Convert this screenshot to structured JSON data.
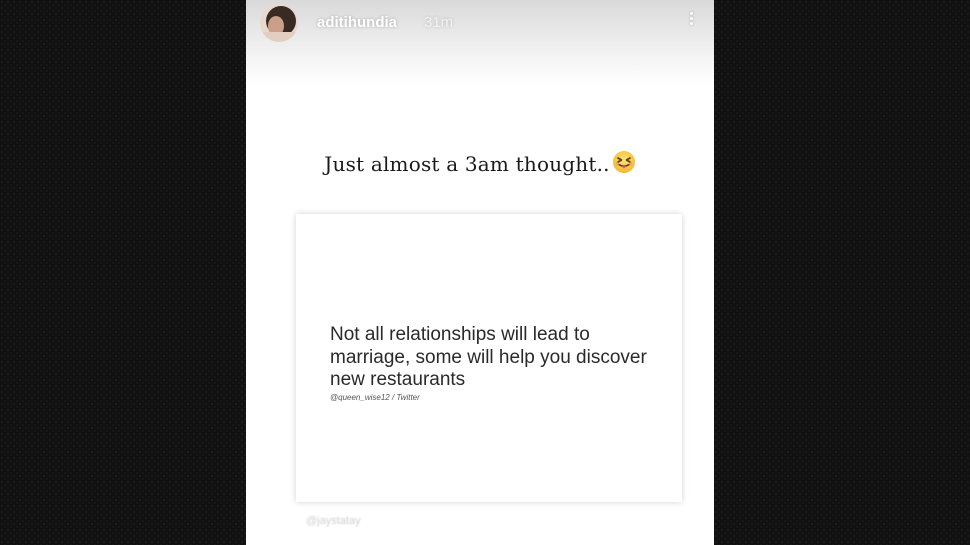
{
  "story": {
    "username": "aditihundia",
    "time_ago": "31m",
    "more_icon": "more-vertical-icon",
    "caption": "Just almost a 3am thought..",
    "caption_emoji": "face-with-tongue-emoji",
    "quote": {
      "text": "Not all relationships will lead to marriage, some will help you discover new restaurants",
      "credit": "@queen_wise12 / Twitter"
    },
    "watermark": "@jaystatay"
  }
}
